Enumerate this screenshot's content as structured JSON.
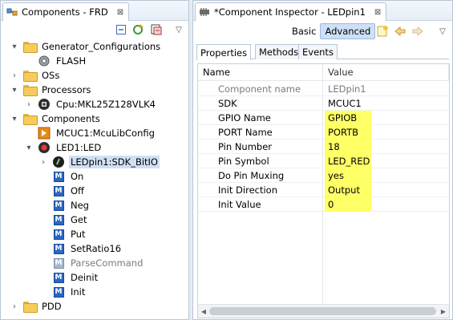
{
  "left_view": {
    "title": "Components - FRD",
    "close_glyph": "⊠",
    "menu_glyph": "▽",
    "toolbar_icons": [
      "collapse-all-icon",
      "refresh-icon",
      "component-library-icon"
    ],
    "tree": [
      {
        "label": "Generator_Configurations",
        "expand": "▾",
        "icon": "folder-icon"
      },
      {
        "label": "FLASH",
        "icon": "gear-icon"
      },
      {
        "label": "OSs",
        "expand": "›",
        "icon": "folder-icon"
      },
      {
        "label": "Processors",
        "expand": "▾",
        "icon": "folder-icon"
      },
      {
        "label": "Cpu:MKL25Z128VLK4",
        "expand": "›",
        "icon": "cpu-icon"
      },
      {
        "label": "Components",
        "expand": "▾",
        "icon": "folder-icon"
      },
      {
        "label": "MCUC1:McuLibConfig",
        "icon": "component-icon"
      },
      {
        "label": "LED1:LED",
        "expand": "▾",
        "icon": "led-icon"
      },
      {
        "label": "LEDpin1:SDK_BitIO",
        "expand": "›",
        "icon": "bitio-icon",
        "selected": true
      },
      {
        "label": "On",
        "icon": "method-icon"
      },
      {
        "label": "Off",
        "icon": "method-icon"
      },
      {
        "label": "Neg",
        "icon": "method-icon"
      },
      {
        "label": "Get",
        "icon": "method-icon"
      },
      {
        "label": "Put",
        "icon": "method-icon"
      },
      {
        "label": "SetRatio16",
        "icon": "method-icon"
      },
      {
        "label": "ParseCommand",
        "icon": "method-disabled-icon",
        "disabled": true
      },
      {
        "label": "Deinit",
        "icon": "method-icon"
      },
      {
        "label": "Init",
        "icon": "method-icon"
      },
      {
        "label": "PDD",
        "expand": "›",
        "icon": "folder-icon"
      }
    ]
  },
  "inspector": {
    "title": "*Component Inspector - LEDpin1",
    "close_glyph": "⊠",
    "basic_label": "Basic",
    "advanced_label": "Advanced",
    "toolbar_icons": [
      "help-note-icon",
      "back-arrow-icon",
      "forward-arrow-icon"
    ],
    "menu_glyph": "▽",
    "tabs": [
      "Properties",
      "Methods",
      "Events"
    ],
    "active_tab": "Properties",
    "columns": {
      "name": "Name",
      "value": "Value"
    },
    "properties": [
      {
        "name": "Component name",
        "value": "LEDpin1",
        "muted": true,
        "highlight": false
      },
      {
        "name": "SDK",
        "value": "MCUC1",
        "muted": false,
        "highlight": false
      },
      {
        "name": "GPIO Name",
        "value": "GPIOB",
        "muted": false,
        "highlight": true
      },
      {
        "name": "PORT Name",
        "value": "PORTB",
        "muted": false,
        "highlight": true
      },
      {
        "name": "Pin Number",
        "value": "18",
        "muted": false,
        "highlight": true
      },
      {
        "name": "Pin Symbol",
        "value": "LED_RED",
        "muted": false,
        "highlight": true
      },
      {
        "name": "Do Pin Muxing",
        "value": "yes",
        "muted": false,
        "highlight": true
      },
      {
        "name": "Init Direction",
        "value": "Output",
        "muted": false,
        "highlight": true
      },
      {
        "name": "Init Value",
        "value": "0",
        "muted": false,
        "highlight": true
      }
    ],
    "highlight_color": "#ffff66",
    "scroll_left_glyph": "◀",
    "scroll_right_glyph": "▶"
  }
}
